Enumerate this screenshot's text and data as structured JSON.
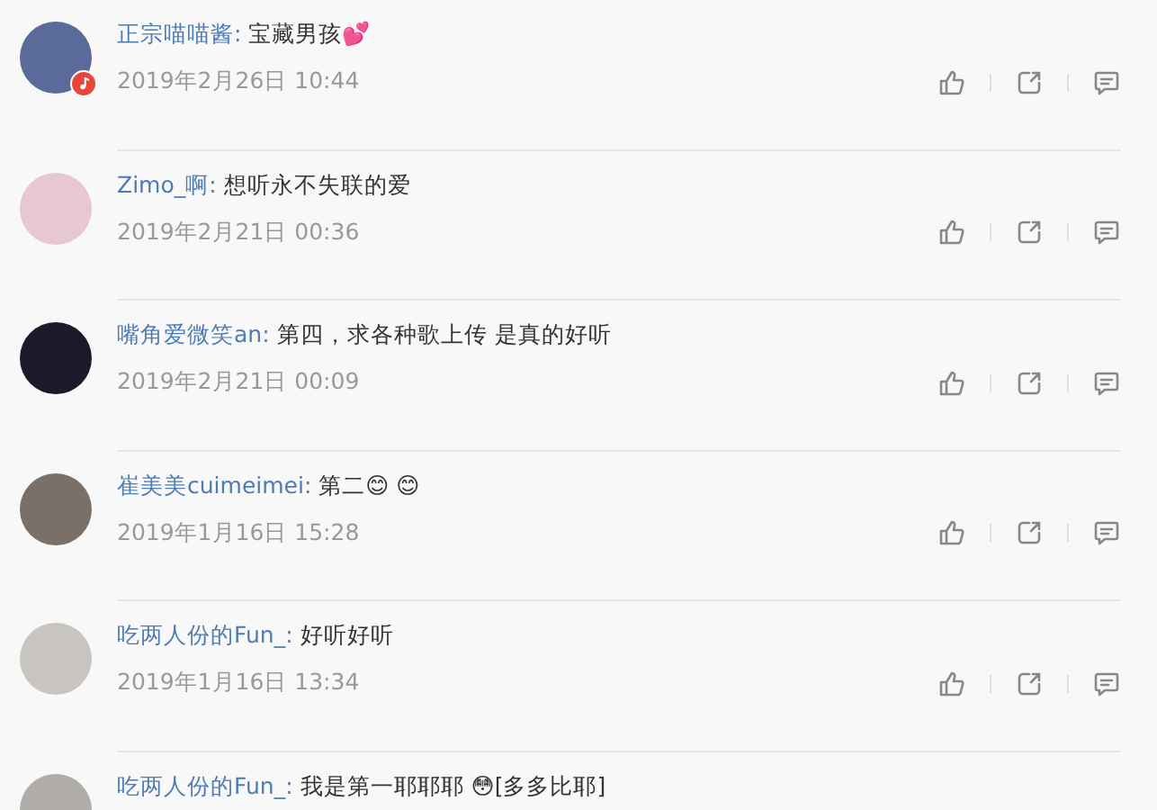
{
  "comments": [
    {
      "user": "正宗喵喵酱:",
      "text": "宝藏男孩💕",
      "time": "2019年2月26日 10:44",
      "music_badge": true
    },
    {
      "user": "Zimo_啊:",
      "text": "想听永不失联的爱",
      "time": "2019年2月21日 00:36",
      "music_badge": false
    },
    {
      "user": "嘴角爱微笑an:",
      "text": "第四，求各种歌上传 是真的好听",
      "time": "2019年2月21日 00:09",
      "music_badge": false
    },
    {
      "user": "崔美美cuimeimei:",
      "text": "第二😊 😊",
      "time": "2019年1月16日 15:28",
      "music_badge": false
    },
    {
      "user": "吃两人份的Fun_:",
      "text": "好听好听",
      "time": "2019年1月16日 13:34",
      "music_badge": false
    },
    {
      "user": "吃两人份的Fun_:",
      "text": "我是第一耶耶耶 😳[多多比耶]",
      "music_badge": false
    }
  ]
}
